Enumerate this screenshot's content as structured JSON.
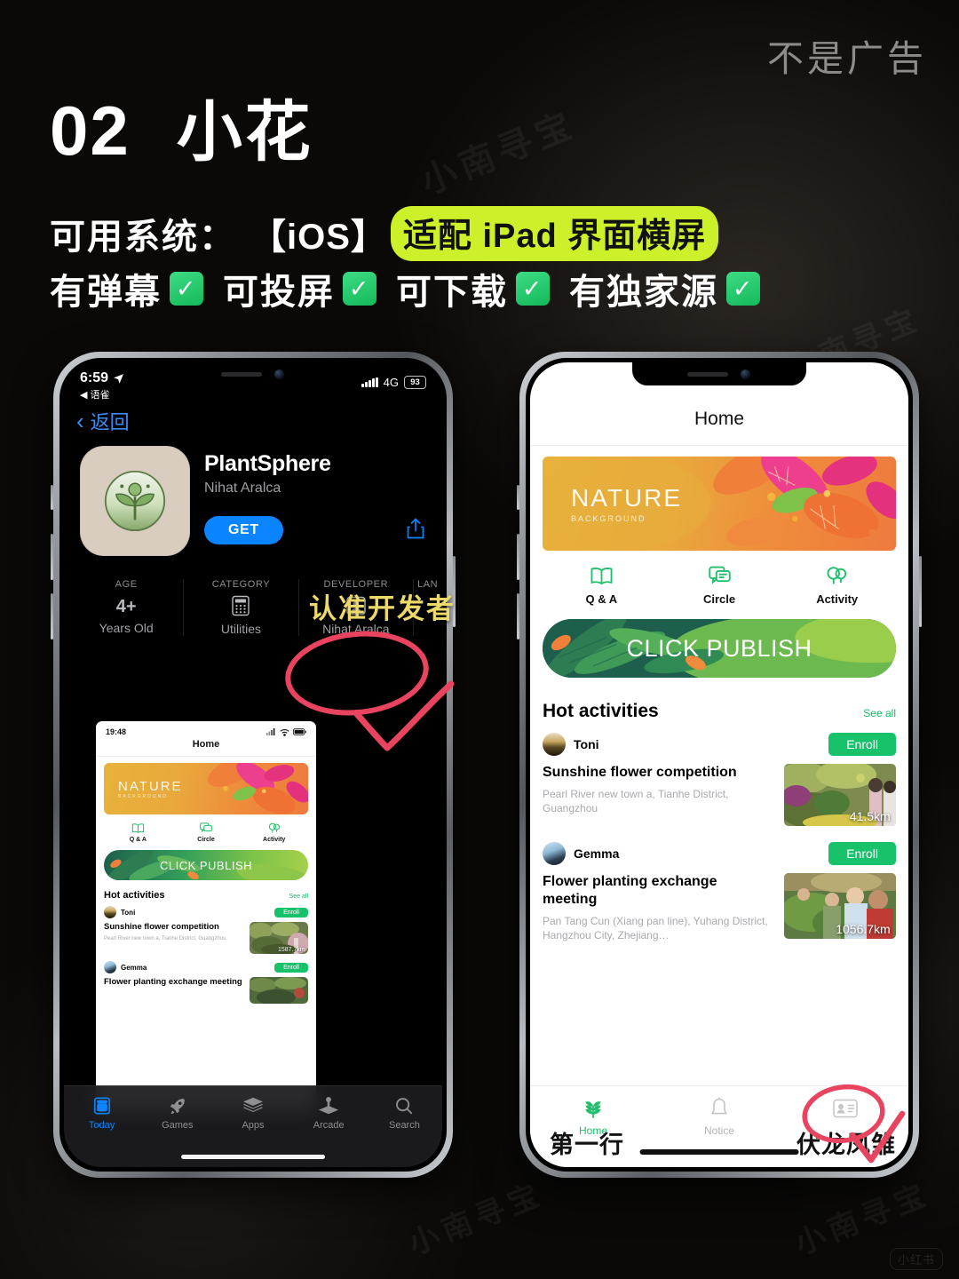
{
  "poster": {
    "corner_note": "不是广告",
    "index": "02",
    "app_title": "小花",
    "system_label": "可用系统：",
    "system_value": "【iOS】",
    "system_badge": "适配 iPad 界面横屏",
    "features": [
      {
        "label": "有弹幕",
        "check": "✓"
      },
      {
        "label": "可投屏",
        "check": "✓"
      },
      {
        "label": "可下载",
        "check": "✓"
      },
      {
        "label": "有独家源",
        "check": "✓"
      }
    ],
    "watermark": "小南寻宝",
    "watermark_badge": "小红书",
    "highlight_color": "#ccf02a",
    "check_color": "#18c26a"
  },
  "left_phone": {
    "status_bar": {
      "time": "6:59",
      "location_arrow": "➤",
      "return_app": "语雀",
      "return_arrow": "◀",
      "network": "4G",
      "battery": "93"
    },
    "nav": {
      "back_label": "返回"
    },
    "app": {
      "name": "PlantSphere",
      "developer": "Nihat Aralca",
      "get_label": "GET",
      "share_icon": "share-icon"
    },
    "info_cells": [
      {
        "label": "AGE",
        "value": "4+",
        "sub": "Years Old"
      },
      {
        "label": "CATEGORY",
        "value": "",
        "sub": "Utilities",
        "icon": "calculator-icon"
      },
      {
        "label": "DEVELOPER",
        "value": "",
        "sub": "Nihat Aralca",
        "icon": "person-icon"
      },
      {
        "label": "LAN",
        "value": "",
        "sub": ""
      }
    ],
    "tabbar": [
      {
        "label": "Today",
        "icon": "today-icon",
        "active": true
      },
      {
        "label": "Games",
        "icon": "rocket-icon",
        "active": false
      },
      {
        "label": "Apps",
        "icon": "stack-icon",
        "active": false
      },
      {
        "label": "Arcade",
        "icon": "arcade-icon",
        "active": false
      },
      {
        "label": "Search",
        "icon": "search-icon",
        "active": false
      }
    ],
    "preview_shot": {
      "status_time": "19:48",
      "title": "Home",
      "banner_main": "NATURE",
      "banner_sub": "BACKGROUND",
      "quick": [
        {
          "label": "Q & A",
          "icon": "book-icon"
        },
        {
          "label": "Circle",
          "icon": "chat-icon"
        },
        {
          "label": "Activity",
          "icon": "balloon-icon"
        }
      ],
      "publish_label": "CLICK PUBLISH",
      "hot_title": "Hot activities",
      "see_all": "See all",
      "activities": [
        {
          "user": "Toni",
          "enroll": "Enroll",
          "title": "Sunshine flower competition",
          "address": "Pearl River new town a, Tianhe District, Guangzhou",
          "distance": "1587.7km"
        },
        {
          "user": "Gemma",
          "enroll": "Enroll",
          "title": "Flower planting exchange meeting",
          "address": "",
          "distance": ""
        }
      ]
    },
    "annotation": {
      "note": "认准开发者",
      "target": "DEVELOPER"
    }
  },
  "right_phone": {
    "header_title": "Home",
    "banner_main": "NATURE",
    "banner_sub": "BACKGROUND",
    "quick": [
      {
        "label": "Q & A",
        "icon": "book-icon"
      },
      {
        "label": "Circle",
        "icon": "chat-icon"
      },
      {
        "label": "Activity",
        "icon": "balloon-icon"
      }
    ],
    "publish_label": "CLICK PUBLISH",
    "hot_title": "Hot activities",
    "see_all": "See all",
    "activities": [
      {
        "user": "Toni",
        "enroll": "Enroll",
        "title": "Sunshine flower competition",
        "address": "Pearl River new town a, Tianhe District, Guangzhou",
        "distance": "41.5km"
      },
      {
        "user": "Gemma",
        "enroll": "Enroll",
        "title": "Flower planting exchange meeting",
        "address": "Pan Tang Cun (Xiang pan line), Yuhang District, Hangzhou City, Zhejiang…",
        "distance": "1056.7km"
      }
    ],
    "tabbar": [
      {
        "label": "Home",
        "icon": "leaf-icon",
        "active": true
      },
      {
        "label": "Notice",
        "icon": "bell-icon",
        "active": false
      },
      {
        "label": "",
        "icon": "contact-card-icon",
        "active": false
      }
    ],
    "overlay_left": "第一行",
    "overlay_right": "伏龙凤雏"
  }
}
